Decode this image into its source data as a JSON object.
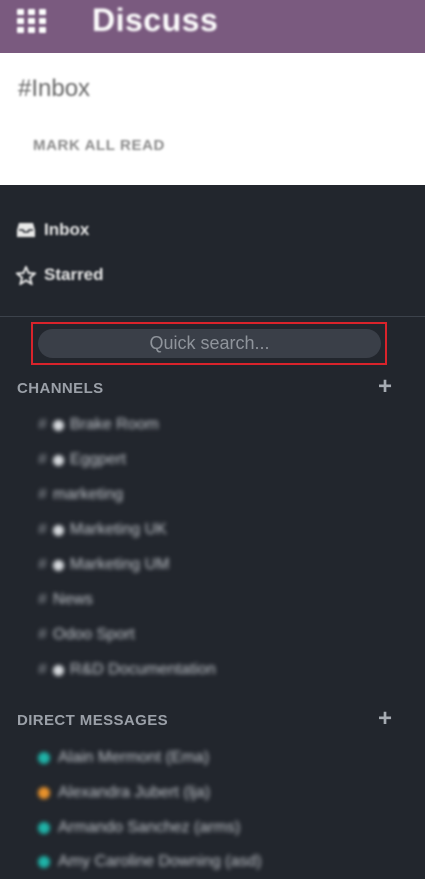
{
  "app": {
    "title": "Discuss"
  },
  "control_panel": {
    "breadcrumb": "#Inbox",
    "mark_all_read": "MARK ALL READ"
  },
  "sidebar": {
    "mailboxes": [
      {
        "label": "Inbox",
        "icon": "inbox-icon"
      },
      {
        "label": "Starred",
        "icon": "star-icon"
      }
    ],
    "search": {
      "placeholder": "Quick search..."
    },
    "channels": {
      "header": "CHANNELS",
      "items": [
        {
          "label": "Brake Room",
          "private": true
        },
        {
          "label": "Eggpert",
          "private": true
        },
        {
          "label": "marketing",
          "private": false
        },
        {
          "label": "Marketing UK",
          "private": true
        },
        {
          "label": "Marketing UM",
          "private": true
        },
        {
          "label": "News",
          "private": false
        },
        {
          "label": "Odoo Sport",
          "private": false
        },
        {
          "label": "R&D Documentation",
          "private": true
        }
      ]
    },
    "direct_messages": {
      "header": "DIRECT MESSAGES",
      "items": [
        {
          "label": "Alain Mermont (Ema)",
          "status_color": "#1fb3a8"
        },
        {
          "label": "Alexandra Jubert (lja)",
          "status_color": "#e8922b"
        },
        {
          "label": "Armando Sanchez (arms)",
          "status_color": "#1fb3a8"
        },
        {
          "label": "Amy Caroline Downing (asd)",
          "status_color": "#1fb3a8"
        }
      ]
    }
  },
  "colors": {
    "topbar": "#7a5a7f",
    "sidebar": "#22262d",
    "highlight": "#d9232b",
    "online": "#1fb3a8",
    "away": "#e8922b"
  }
}
